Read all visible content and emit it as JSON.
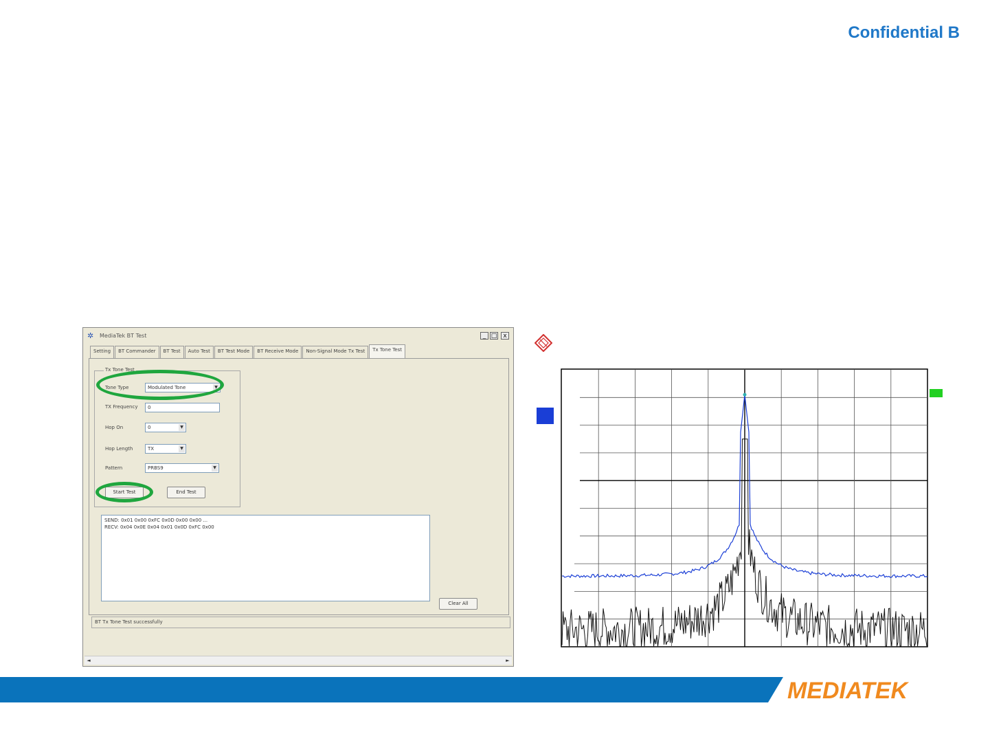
{
  "header": {
    "confidential": "Confidential B"
  },
  "window": {
    "title": "MediaTek BT Test",
    "controls": {
      "minimize": "_",
      "maximize": "□",
      "close": "x"
    },
    "tabs": [
      {
        "label": "Setting"
      },
      {
        "label": "BT Commander"
      },
      {
        "label": "BT Test"
      },
      {
        "label": "Auto Test"
      },
      {
        "label": "BT Test Mode"
      },
      {
        "label": "BT Receive Mode"
      },
      {
        "label": "Non-Signal Mode Tx Test"
      },
      {
        "label": "Tx Tone Test"
      }
    ],
    "group_label": "Tx Tone Test",
    "fields": {
      "tone_type": {
        "label": "Tone Type",
        "value": "Modulated Tone"
      },
      "tx_frequency": {
        "label": "TX Frequency",
        "value": "0"
      },
      "hop_on": {
        "label": "Hop On",
        "value": "0"
      },
      "hop_length": {
        "label": "Hop Length",
        "value": "TX"
      },
      "pattern": {
        "label": "Pattern",
        "value": "PRBS9"
      }
    },
    "buttons": {
      "start": "Start Test",
      "end": "End Test",
      "clear": "Clear All"
    },
    "log": [
      "SEND: 0x01 0x00 0xFC 0x0D 0x00 0x00 ...",
      "RECV: 0x04 0x0E 0x04 0x01 0x0D 0xFC 0x00"
    ],
    "status": "BT Tx Tone Test successfully"
  },
  "footer": {
    "brand": "MEDIATEK",
    "bar_color": "#0a73bb",
    "logo_color": "#f08a1f"
  },
  "chart_data": {
    "type": "line",
    "title": "",
    "xlabel": "",
    "ylabel": "",
    "grid": true,
    "xlim": [
      0,
      10
    ],
    "ylim": [
      0,
      10
    ],
    "peak_x": 5,
    "peak_y": 9.1,
    "series": [
      {
        "color": "#1a3ed6"
      },
      {
        "color": "#111111"
      }
    ]
  }
}
